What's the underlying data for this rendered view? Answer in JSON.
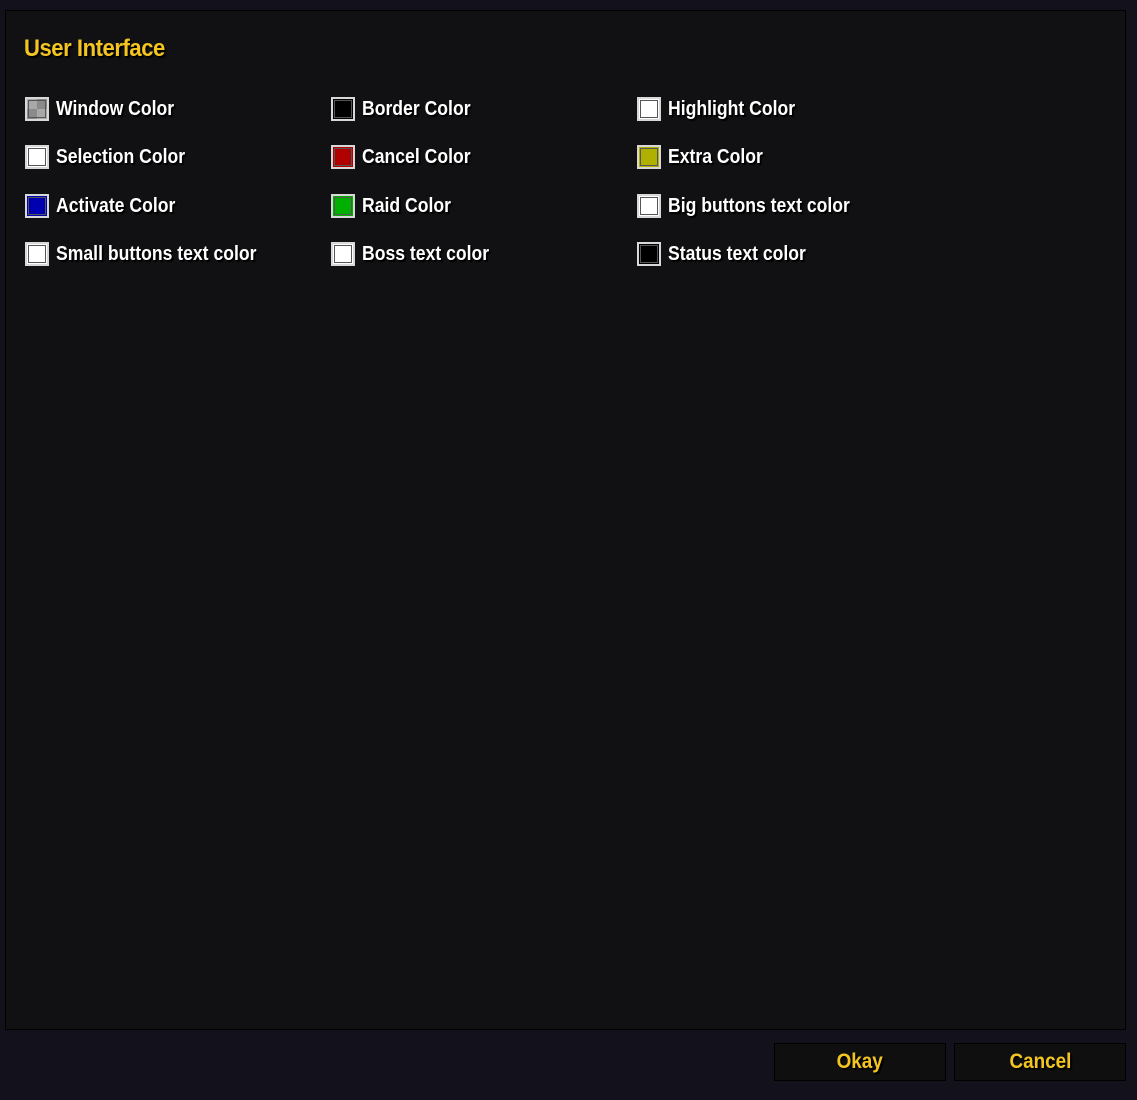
{
  "dialog": {
    "title": "User Interface"
  },
  "color_options": [
    {
      "label": "Window Color",
      "color": "checker",
      "name": "window-color"
    },
    {
      "label": "Border Color",
      "color": "#000000",
      "name": "border-color"
    },
    {
      "label": "Highlight Color",
      "color": "#ffffff",
      "name": "highlight-color"
    },
    {
      "label": "Selection Color",
      "color": "#ffffff",
      "name": "selection-color"
    },
    {
      "label": "Cancel Color",
      "color": "#b00000",
      "name": "cancel-color"
    },
    {
      "label": "Extra Color",
      "color": "#b0b000",
      "name": "extra-color"
    },
    {
      "label": "Activate Color",
      "color": "#0000b0",
      "name": "activate-color"
    },
    {
      "label": "Raid Color",
      "color": "#00b000",
      "name": "raid-color"
    },
    {
      "label": "Big buttons text color",
      "color": "#ffffff",
      "name": "big-buttons-text-color"
    },
    {
      "label": "Small buttons text color",
      "color": "#ffffff",
      "name": "small-buttons-text-color"
    },
    {
      "label": "Boss text color",
      "color": "#ffffff",
      "name": "boss-text-color"
    },
    {
      "label": "Status text color",
      "color": "#000000",
      "name": "status-text-color"
    }
  ],
  "buttons": {
    "okay": "Okay",
    "cancel": "Cancel"
  },
  "colors": {
    "accent": "#f4c521",
    "panel_bg": "#111113",
    "page_bg": "#13121c"
  }
}
